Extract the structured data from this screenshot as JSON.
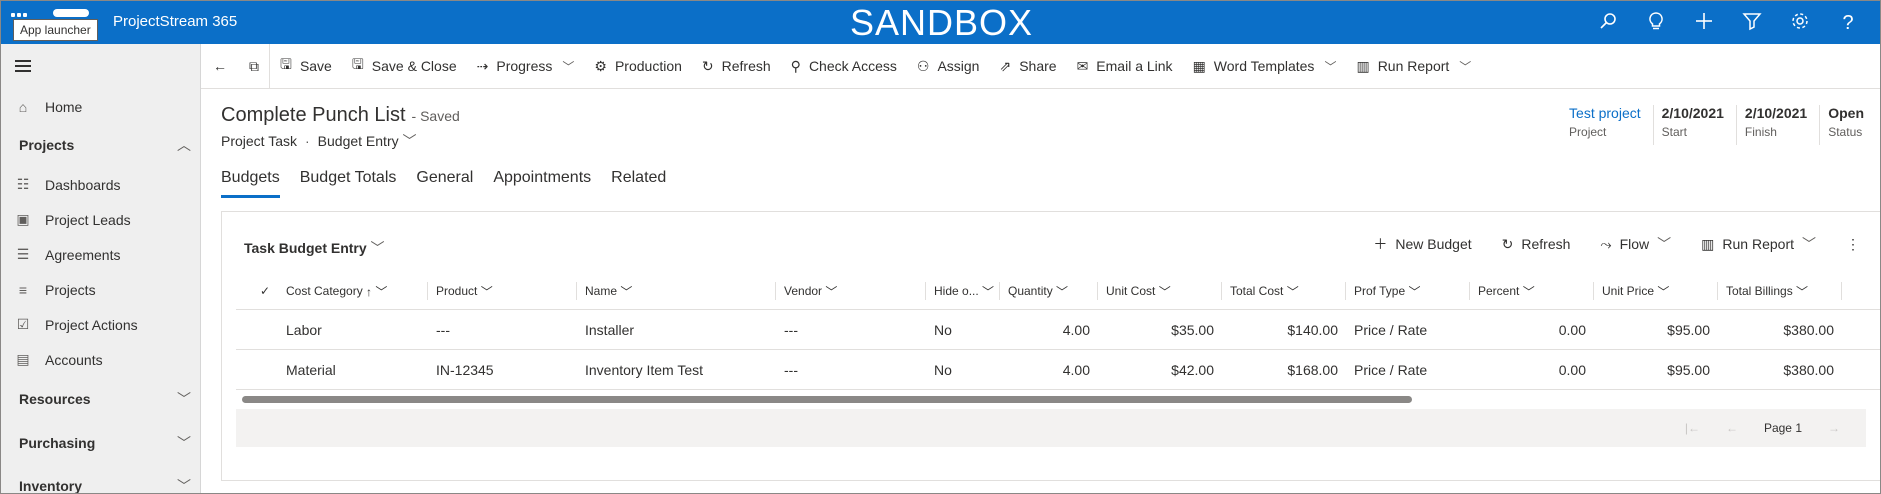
{
  "topbar": {
    "app_name": "ProjectStream 365",
    "environment_banner": "SANDBOX",
    "tooltip": "App launcher",
    "icons": [
      "search-icon",
      "lightbulb-icon",
      "plus-icon",
      "filter-icon",
      "gear-icon",
      "help-icon"
    ],
    "bg_color": "#0b6fc8"
  },
  "sidebar": {
    "home": "Home",
    "projects_group": "Projects",
    "items": [
      "Dashboards",
      "Project Leads",
      "Agreements",
      "Projects",
      "Project Actions",
      "Accounts"
    ],
    "groups": [
      "Resources",
      "Purchasing",
      "Inventory"
    ]
  },
  "commands": [
    {
      "label": "Save",
      "icon": "save-icon"
    },
    {
      "label": "Save & Close",
      "icon": "save-close-icon"
    },
    {
      "label": "Progress",
      "icon": "progress-icon",
      "dropdown": true
    },
    {
      "label": "Production",
      "icon": "gear-icon"
    },
    {
      "label": "Refresh",
      "icon": "refresh-icon"
    },
    {
      "label": "Check Access",
      "icon": "search-icon"
    },
    {
      "label": "Assign",
      "icon": "person-icon"
    },
    {
      "label": "Share",
      "icon": "share-icon"
    },
    {
      "label": "Email a Link",
      "icon": "email-icon"
    },
    {
      "label": "Word Templates",
      "icon": "word-icon",
      "dropdown": true
    },
    {
      "label": "Run Report",
      "icon": "report-icon",
      "dropdown": true
    }
  ],
  "record": {
    "title": "Complete Punch List",
    "saved": "- Saved",
    "entity": "Project Task",
    "form": "Budget Entry",
    "fields": [
      {
        "value": "Test project",
        "label": "Project",
        "link": true
      },
      {
        "value": "2/10/2021",
        "label": "Start"
      },
      {
        "value": "2/10/2021",
        "label": "Finish"
      },
      {
        "value": "Open",
        "label": "Status"
      }
    ]
  },
  "tabs": [
    "Budgets",
    "Budget Totals",
    "General",
    "Appointments",
    "Related"
  ],
  "grid": {
    "view_name": "Task Budget Entry",
    "actions": {
      "new": "New Budget",
      "refresh": "Refresh",
      "flow": "Flow",
      "report": "Run Report"
    },
    "columns": [
      "Cost Category",
      "Product",
      "Name",
      "Vendor",
      "Hide o...",
      "Quantity",
      "Unit Cost",
      "Total Cost",
      "Prof Type",
      "Percent",
      "Unit Price",
      "Total Billings"
    ],
    "rows": [
      [
        "Labor",
        "---",
        "Installer",
        "---",
        "No",
        "4.00",
        "$35.00",
        "$140.00",
        "Price / Rate",
        "0.00",
        "$95.00",
        "$380.00"
      ],
      [
        "Material",
        "IN-12345",
        "Inventory Item Test",
        "---",
        "No",
        "4.00",
        "$42.00",
        "$168.00",
        "Price / Rate",
        "0.00",
        "$95.00",
        "$380.00"
      ]
    ],
    "page_label": "Page 1"
  }
}
